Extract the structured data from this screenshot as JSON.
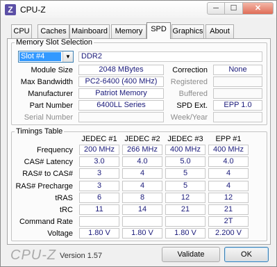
{
  "window": {
    "title": "CPU-Z",
    "icon_letter": "Z",
    "min_glyph": "─",
    "max_glyph": "☐",
    "close_glyph": "✕"
  },
  "tabs": [
    "CPU",
    "Caches",
    "Mainboard",
    "Memory",
    "SPD",
    "Graphics",
    "About"
  ],
  "active_tab": "SPD",
  "memory_slot": {
    "legend": "Memory Slot Selection",
    "slot_selected": "Slot #4",
    "type": "DDR2",
    "module_size_label": "Module Size",
    "module_size": "2048 MBytes",
    "max_bandwidth_label": "Max Bandwidth",
    "max_bandwidth": "PC2-6400 (400 MHz)",
    "manufacturer_label": "Manufacturer",
    "manufacturer": "Patriot Memory",
    "part_number_label": "Part Number",
    "part_number": "6400LL Series",
    "serial_number_label": "Serial Number",
    "serial_number": "",
    "correction_label": "Correction",
    "correction": "None",
    "registered_label": "Registered",
    "registered": "",
    "buffered_label": "Buffered",
    "buffered": "",
    "spd_ext_label": "SPD Ext.",
    "spd_ext": "EPP 1.0",
    "week_year_label": "Week/Year",
    "week_year": ""
  },
  "timings": {
    "legend": "Timings Table",
    "columns": [
      "JEDEC #1",
      "JEDEC #2",
      "JEDEC #3",
      "EPP #1"
    ],
    "rows": [
      {
        "label": "Frequency",
        "values": [
          "200 MHz",
          "266 MHz",
          "400 MHz",
          "400 MHz"
        ]
      },
      {
        "label": "CAS# Latency",
        "values": [
          "3.0",
          "4.0",
          "5.0",
          "4.0"
        ]
      },
      {
        "label": "RAS# to CAS#",
        "values": [
          "3",
          "4",
          "5",
          "4"
        ]
      },
      {
        "label": "RAS# Precharge",
        "values": [
          "3",
          "4",
          "5",
          "4"
        ]
      },
      {
        "label": "tRAS",
        "values": [
          "6",
          "8",
          "12",
          "12"
        ]
      },
      {
        "label": "tRC",
        "values": [
          "11",
          "14",
          "21",
          "21"
        ]
      },
      {
        "label": "Command Rate",
        "values": [
          "",
          "",
          "",
          "2T"
        ]
      },
      {
        "label": "Voltage",
        "values": [
          "1.80 V",
          "1.80 V",
          "1.80 V",
          "2.200 V"
        ]
      }
    ]
  },
  "footer": {
    "logo": "CPU-Z",
    "version": "Version 1.57",
    "validate_label": "Validate",
    "ok_label": "OK"
  }
}
